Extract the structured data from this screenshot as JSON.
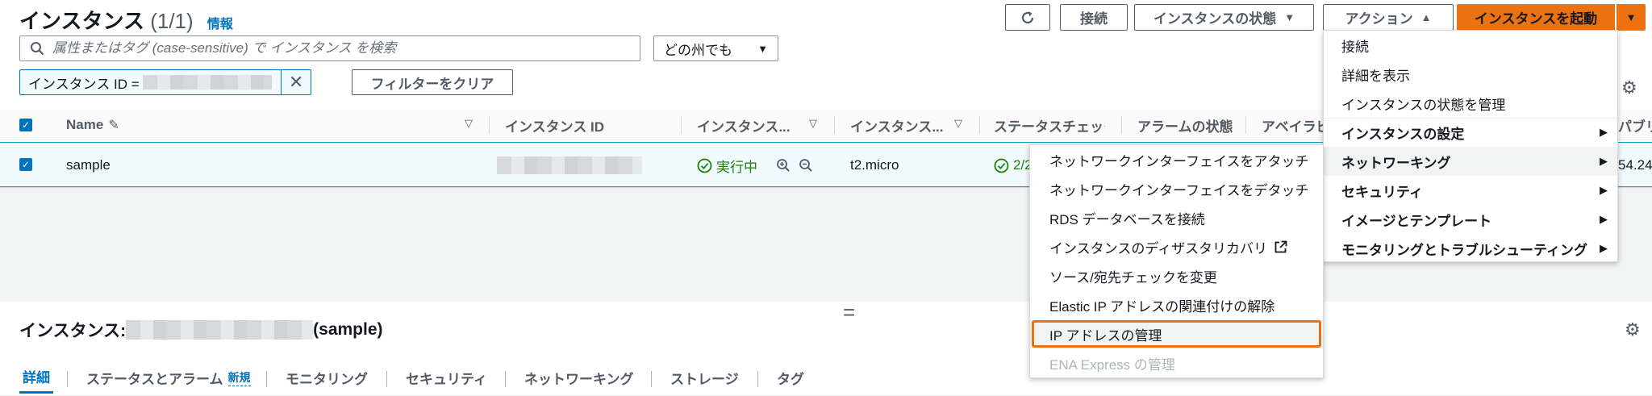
{
  "header": {
    "title": "インスタンス",
    "count": "(1/1)",
    "info_link": "情報",
    "connect_button": "接続",
    "instance_state_button": "インスタンスの状態",
    "actions_button": "アクション",
    "launch_button": "インスタンスを起動"
  },
  "search": {
    "placeholder": "属性またはタグ (case-sensitive) で インスタンス を検索",
    "region_select": "どの州でも"
  },
  "filter": {
    "token_label": "インスタンス ID =",
    "clear_button": "フィルターをクリア"
  },
  "table": {
    "columns": [
      "Name",
      "インスタンス ID",
      "インスタンス...",
      "インスタンス...",
      "ステータスチェック",
      "アラームの状態",
      "アベイラビ",
      "パブリ"
    ],
    "row": {
      "name": "sample",
      "state": "実行中",
      "type": "t2.micro",
      "status_check": "2/2",
      "public_ip_fragment": "54.24"
    }
  },
  "details": {
    "title_prefix": "インスタンス:",
    "title_suffix": "(sample)",
    "tabs": [
      "詳細",
      "ステータスとアラーム",
      "モニタリング",
      "セキュリティ",
      "ネットワーキング",
      "ストレージ",
      "タグ"
    ],
    "new_badge": "新規"
  },
  "actions_menu": {
    "items": [
      {
        "label": "接続"
      },
      {
        "label": "詳細を表示"
      },
      {
        "label": "インスタンスの状態を管理"
      },
      {
        "label": "インスタンスの設定"
      },
      {
        "label": "ネットワーキング"
      },
      {
        "label": "セキュリティ"
      },
      {
        "label": "イメージとテンプレート"
      },
      {
        "label": "モニタリングとトラブルシューティング"
      }
    ]
  },
  "networking_submenu": {
    "items": [
      {
        "label": "ネットワークインターフェイスをアタッチ"
      },
      {
        "label": "ネットワークインターフェイスをデタッチ"
      },
      {
        "label": "RDS データベースを接続"
      },
      {
        "label": "インスタンスのディザスタリカバリ"
      },
      {
        "label": "ソース/宛先チェックを変更"
      },
      {
        "label": "Elastic IP アドレスの関連付けの解除"
      },
      {
        "label": "IP アドレスの管理"
      },
      {
        "label": "ENA Express の管理"
      }
    ]
  },
  "colors": {
    "primary_orange": "#ec7211",
    "link_blue": "#0073bb",
    "running_green": "#1d8102"
  }
}
